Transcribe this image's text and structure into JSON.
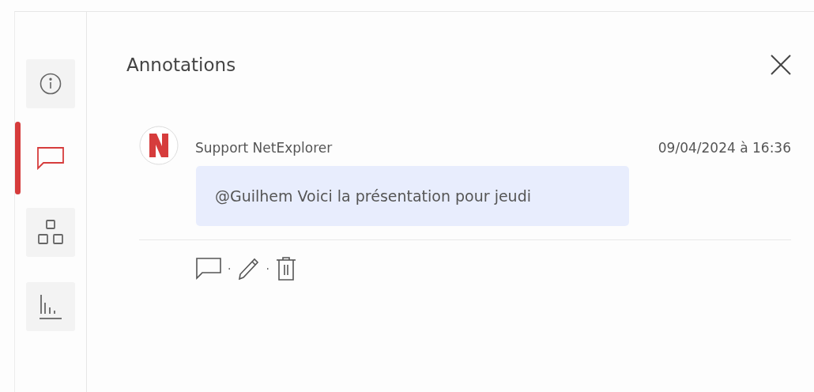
{
  "sidebar": {
    "items": [
      {
        "kind": "info",
        "selected": false
      },
      {
        "kind": "comment",
        "selected": true
      },
      {
        "kind": "shapes",
        "selected": false
      },
      {
        "kind": "stats",
        "selected": false
      }
    ]
  },
  "panel": {
    "title": "Annotations",
    "comments": [
      {
        "author": "Support NetExplorer",
        "date": "09/04/2024 à 16:36",
        "message": "@Guilhem Voici la présentation pour jeudi",
        "actions": [
          {
            "kind": "reply"
          },
          {
            "kind": "edit"
          },
          {
            "kind": "delete"
          }
        ],
        "separator": "·"
      }
    ]
  }
}
